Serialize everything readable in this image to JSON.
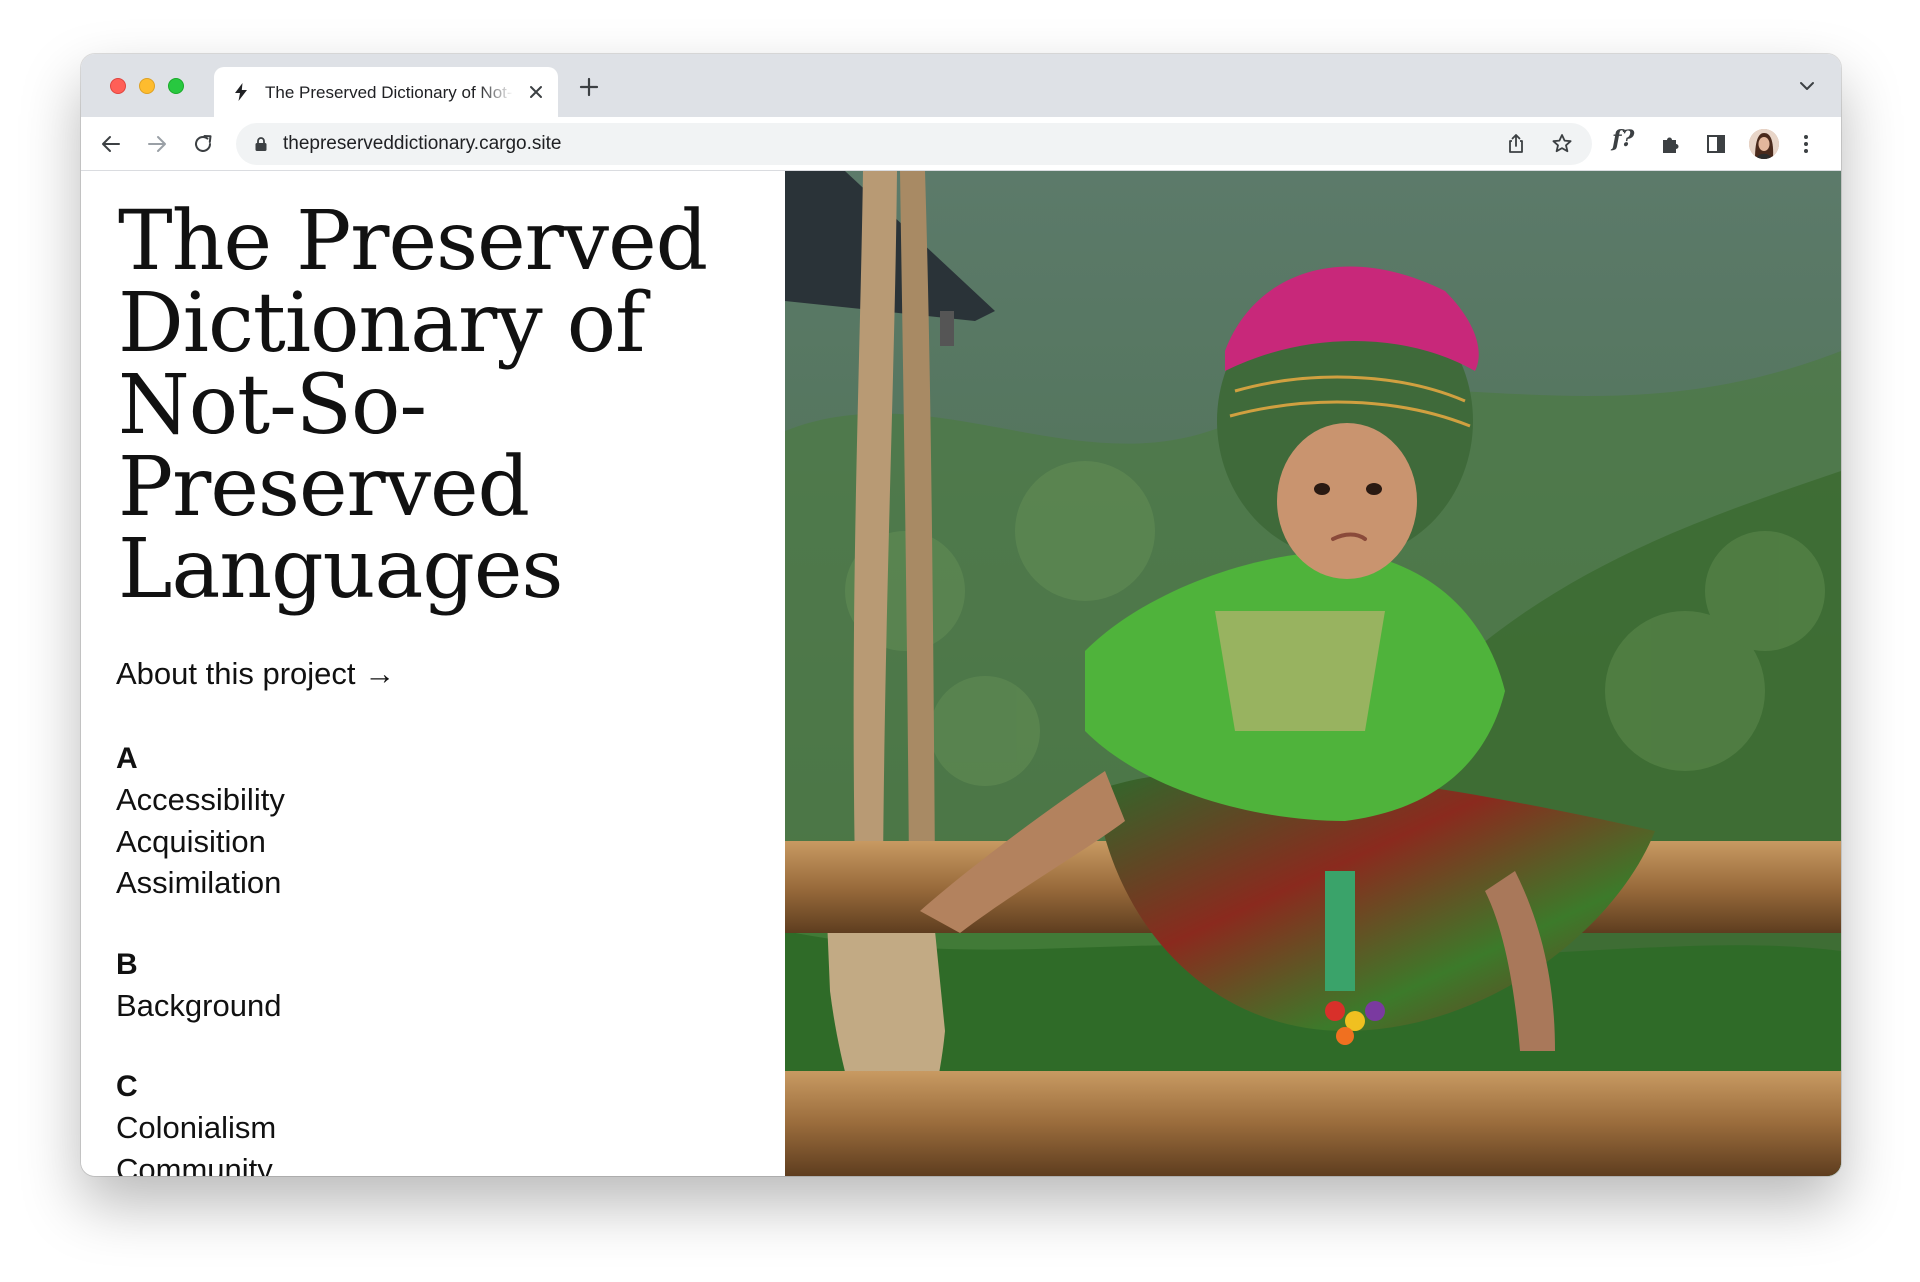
{
  "browser": {
    "tab": {
      "title": "The Preserved Dictionary of Not-So-Preserved Languages",
      "favicon": "bolt-icon"
    },
    "address_bar": {
      "url": "thepreserveddictionary.cargo.site"
    },
    "icons": [
      "back-arrow-icon",
      "forward-arrow-icon",
      "reload-icon",
      "lock-icon",
      "share-icon",
      "bookmark-star-icon",
      "font-finder-extension-icon",
      "puzzle-extensions-icon",
      "side-panel-icon",
      "profile-avatar",
      "more-menu-icon"
    ],
    "extension_label": "f?"
  },
  "page": {
    "title": "The Preserved Dictionary of Not-So-Preserved Languages",
    "about_link": "About this project →",
    "glossary": [
      {
        "letter": "A",
        "terms": [
          "Accessibility",
          "Acquisition",
          "Assimilation"
        ]
      },
      {
        "letter": "B",
        "terms": [
          "Background"
        ]
      },
      {
        "letter": "C",
        "terms": [
          "Colonialism",
          "Community"
        ]
      }
    ],
    "hero_image": {
      "subject": "child-in-traditional-embroidered-dress-sitting-on-wooden-rail"
    }
  }
}
